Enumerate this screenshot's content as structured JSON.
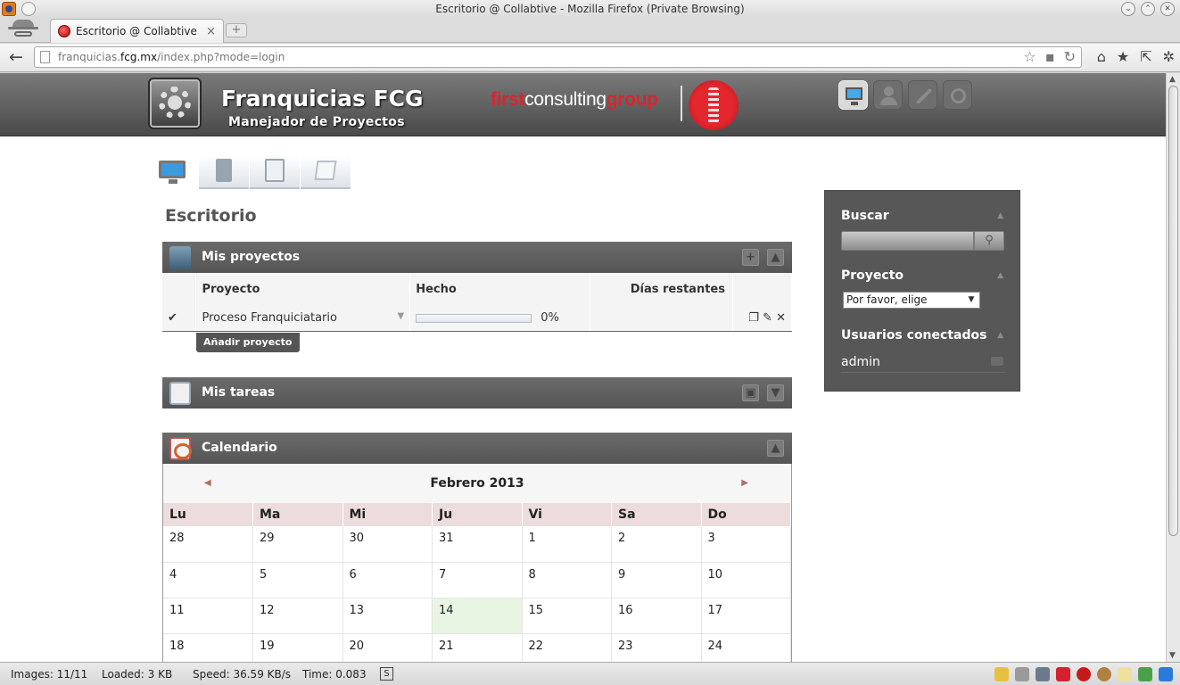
{
  "window": {
    "title": "Escritorio @ Collabtive - Mozilla Firefox (Private Browsing)"
  },
  "browser": {
    "tab_title": "Escritorio @ Collabtive",
    "url_prefix": "franquicias.",
    "url_host": "fcg.mx",
    "url_path": "/index.php?mode=login"
  },
  "header": {
    "site_title": "Franquicias FCG",
    "site_subtitle": "Manejador de Proyectos",
    "brand_part1": "first",
    "brand_part2": "consulting",
    "brand_part3": "group"
  },
  "page": {
    "heading": "Escritorio"
  },
  "projects_panel": {
    "title": "Mis proyectos",
    "columns": [
      "Proyecto",
      "Hecho",
      "Días restantes"
    ],
    "rows": [
      {
        "name": "Proceso Franquiciatario",
        "done_percent": 0,
        "done_label": "0%",
        "days_left": ""
      }
    ],
    "add_button": "Añadir proyecto"
  },
  "tasks_panel": {
    "title": "Mis tareas"
  },
  "calendar_panel": {
    "title": "Calendario",
    "month_label": "Febrero 2013",
    "weekdays": [
      "Lu",
      "Ma",
      "Mi",
      "Ju",
      "Vi",
      "Sa",
      "Do"
    ],
    "weeks": [
      [
        "28",
        "29",
        "30",
        "31",
        "1",
        "2",
        "3"
      ],
      [
        "4",
        "5",
        "6",
        "7",
        "8",
        "9",
        "10"
      ],
      [
        "11",
        "12",
        "13",
        "14",
        "15",
        "16",
        "17"
      ],
      [
        "18",
        "19",
        "20",
        "21",
        "22",
        "23",
        "24"
      ]
    ],
    "today": "14"
  },
  "sidebar": {
    "search_title": "Buscar",
    "project_title": "Proyecto",
    "project_select_value": "Por favor, elige",
    "users_title": "Usuarios conectados",
    "users": [
      "admin"
    ]
  },
  "statusbar": {
    "images": "Images: 11/11",
    "loaded": "Loaded: 3 KB",
    "speed": "Speed: 36.59 KB/s",
    "time": "Time: 0.083",
    "s_label": "S"
  }
}
